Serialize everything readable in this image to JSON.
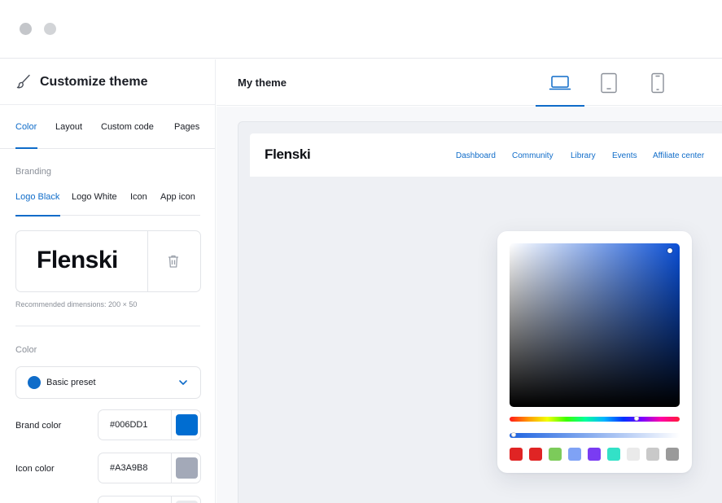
{
  "sidebar": {
    "title": "Customize theme",
    "tabs": [
      {
        "label": "Color",
        "active": true
      },
      {
        "label": "Layout",
        "active": false
      },
      {
        "label": "Custom code",
        "active": false
      },
      {
        "label": "Pages",
        "active": false
      }
    ],
    "branding": {
      "section_label": "Branding",
      "sub_tabs": [
        {
          "label": "Logo Black",
          "active": true
        },
        {
          "label": "Logo White",
          "active": false
        },
        {
          "label": "Icon",
          "active": false
        },
        {
          "label": "App icon",
          "active": false
        }
      ],
      "logo_text": "Flenski",
      "dimensions_hint": "Recommended dimensions: 200 × 50"
    },
    "color": {
      "section_label": "Color",
      "preset": {
        "label": "Basic preset",
        "swatch": "#006DD1"
      },
      "rows": [
        {
          "label": "Brand color",
          "value": "#006DD1",
          "swatch": "#006DD1"
        },
        {
          "label": "Icon color",
          "value": "#A3A9B8",
          "swatch": "#A3A9B8"
        }
      ]
    }
  },
  "main": {
    "title": "My theme",
    "devices": [
      {
        "name": "laptop-icon",
        "active": true
      },
      {
        "name": "tablet-icon",
        "active": false
      },
      {
        "name": "phone-icon",
        "active": false
      }
    ],
    "preview": {
      "logo": "Flenski",
      "nav_links": [
        "Dashboard",
        "Community",
        "Library",
        "Events",
        "Affiliate center"
      ]
    }
  },
  "color_picker": {
    "presets": [
      "#E02424",
      "#E02424",
      "#7CCB5A",
      "#7FA2F5",
      "#7A3CF2",
      "#33E1C7",
      "#EAEAEA",
      "#C9C9C9",
      "#9A9A9A"
    ]
  },
  "colors": {
    "accent": "#0F6CC9",
    "muted_text": "#8A8F98",
    "border": "#E2E4E8"
  }
}
